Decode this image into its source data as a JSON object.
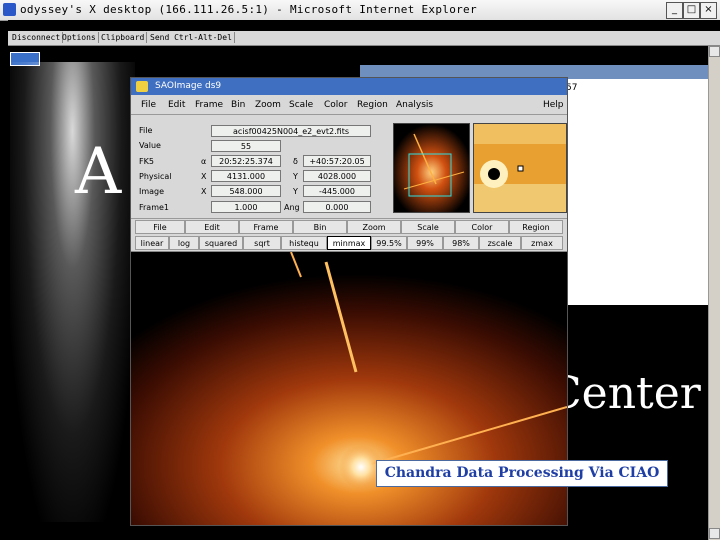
{
  "window": {
    "title": "odyssey's X desktop (166.111.26.5:1) - Microsoft Internet Explorer",
    "controls": {
      "minimize": "_",
      "maximize": "□",
      "close": "×"
    }
  },
  "vnc_toolbar": {
    "items": [
      "Disconnect",
      "Options",
      "Clipboard",
      "Send Ctrl-Alt-Del"
    ]
  },
  "desktop": {
    "big_letter": "A",
    "background_heading": "Center",
    "right_panel_snippet": "57"
  },
  "ds9": {
    "title": "SAOImage ds9",
    "menu": [
      "File",
      "Edit",
      "Frame",
      "Bin",
      "Zoom",
      "Scale",
      "Color",
      "Region",
      "Analysis",
      "Help"
    ],
    "info": {
      "file_label": "File",
      "file_value": "acisf00425N004_e2_evt2.fits",
      "value_label": "Value",
      "value_value": "55",
      "fk5_label": "FK5",
      "alpha": "α",
      "ra": "20:52:25.374",
      "delta": "δ",
      "dec": "+40:57:20.05",
      "physical_label": "Physical",
      "physical_x_label": "X",
      "physical_x": "4131.000",
      "physical_y_label": "Y",
      "physical_y": "4028.000",
      "image_label": "Image",
      "image_x_label": "X",
      "image_x": "548.000",
      "image_y_label": "Y",
      "image_y": "-445.000",
      "frame_label": "Frame1",
      "zoom_value": "1.000",
      "ang_label": "Ang",
      "angle_value": "0.000"
    },
    "buttonbar_main": [
      "File",
      "Edit",
      "Frame",
      "Bin",
      "Zoom",
      "Scale",
      "Color",
      "Region"
    ],
    "buttonbar_scale": [
      "linear",
      "log",
      "squared",
      "sqrt",
      "histequ",
      "minmax",
      "99.5%",
      "99%",
      "98%",
      "zscale",
      "zmax"
    ],
    "active_scale": "minmax"
  },
  "caption": "Chandra Data Processing Via CIAO",
  "colors": {
    "window_titlebar": "#f0f0f0",
    "ds9_titlebar": "#3f6fc0",
    "caption_text": "#1f3fa5",
    "image_hot": "#e8801a"
  }
}
